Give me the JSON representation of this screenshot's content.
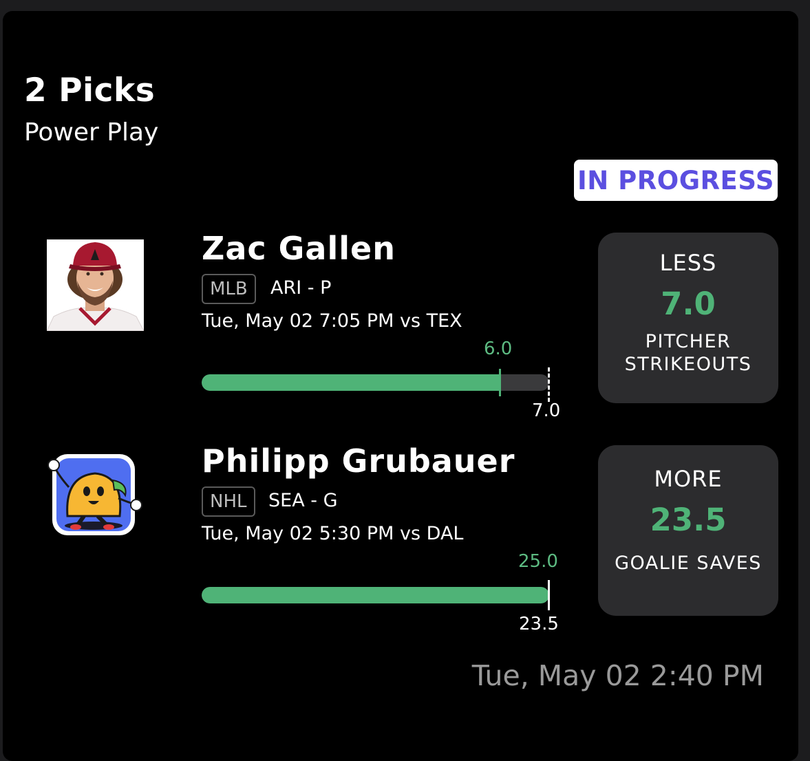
{
  "header": {
    "title": "2 Picks",
    "subtitle": "Power Play",
    "status": "IN PROGRESS"
  },
  "picks": [
    {
      "name": "Zac Gallen",
      "league": "MLB",
      "team_pos": "ARI - P",
      "game_time": "Tue, May 02 7:05 PM  vs TEX",
      "current_value": "6.0",
      "target_value": "7.0",
      "progress_fraction": 0.857,
      "direction": "LESS",
      "line": "7.0",
      "stat": "PITCHER STRIKEOUTS"
    },
    {
      "name": "Philipp Grubauer",
      "league": "NHL",
      "team_pos": "SEA - G",
      "game_time": "Tue, May 02 5:30 PM  vs DAL",
      "current_value": "25.0",
      "target_value": "23.5",
      "progress_fraction": 1.0,
      "direction": "MORE",
      "line": "23.5",
      "stat": "GOALIE SAVES"
    }
  ],
  "footer": {
    "timestamp": "Tue, May 02 2:40 PM"
  },
  "colors": {
    "accent_green": "#4fb377",
    "status_purple": "#5b4fe0",
    "background": "#000000"
  },
  "icons": [
    "player-headshot-icon",
    "taco-mascot-icon"
  ]
}
